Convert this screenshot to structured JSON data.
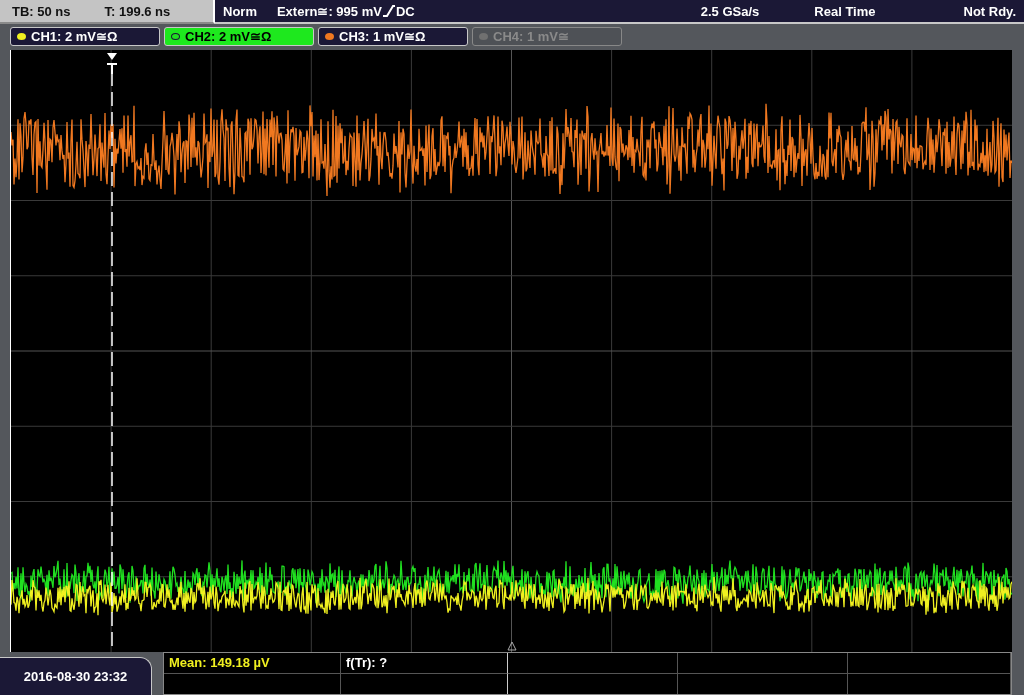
{
  "top_bar": {
    "timebase": "TB: 50 ns",
    "trigger_time": "T: 199.6 ns",
    "mode": "Norm",
    "trigger": "Extern≅: 995 mV",
    "coupling": "DC",
    "sample_rate": "2.5 GSa/s",
    "acquisition": "Real Time",
    "status": "Not Rdy."
  },
  "channels": [
    {
      "label": "CH1: 2 mV≅Ω",
      "color": "#f0f020",
      "selected": false,
      "disabled": false
    },
    {
      "label": "CH2: 2 mV≅Ω",
      "color": "#20e020",
      "selected": true,
      "disabled": false
    },
    {
      "label": "CH3: 1 mV≅Ω",
      "color": "#f07820",
      "selected": false,
      "disabled": false
    },
    {
      "label": "CH4: 1 mV≅",
      "color": "#707070",
      "selected": false,
      "disabled": true
    }
  ],
  "measurements": [
    {
      "text": "Mean: 149.18 µV",
      "color": "#f0f020"
    },
    {
      "text": "f(Tr): ?",
      "color": "#ffffff"
    }
  ],
  "date_time": "2016-08-30 23:32"
}
